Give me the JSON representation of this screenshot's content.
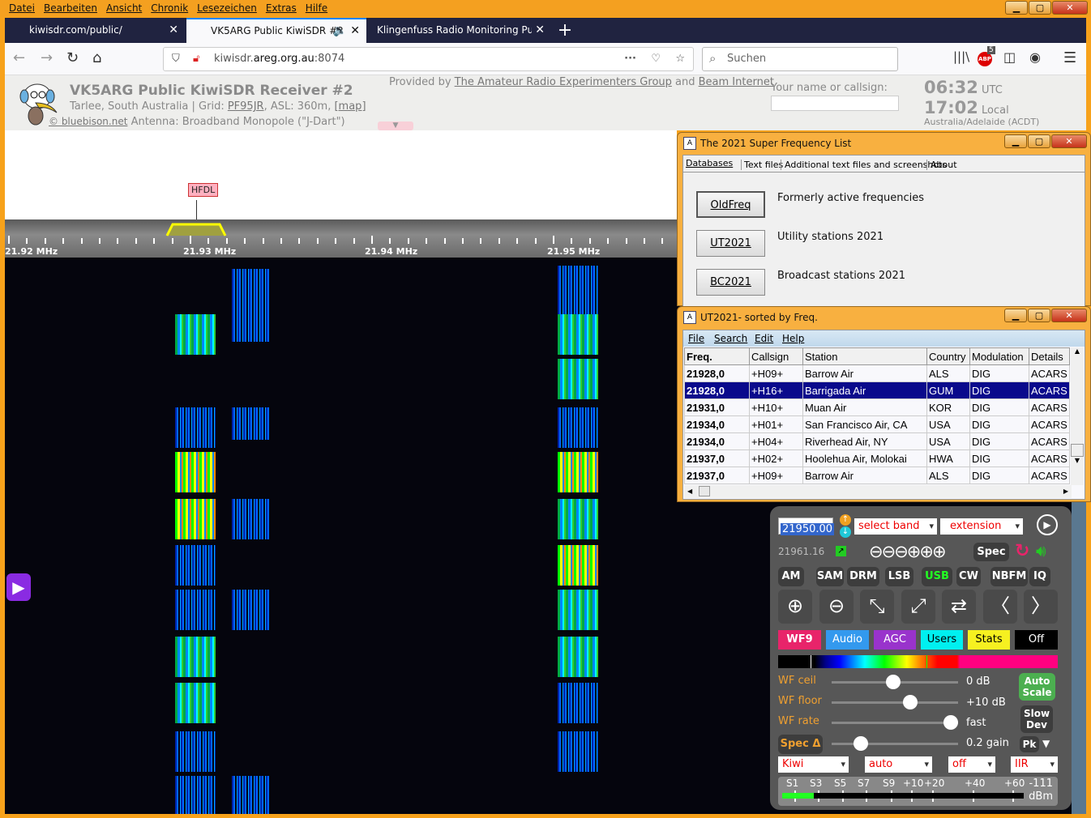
{
  "browser": {
    "menu": [
      "Datei",
      "Bearbeiten",
      "Ansicht",
      "Chronik",
      "Lesezeichen",
      "Extras",
      "Hilfe"
    ],
    "tabs": [
      {
        "label": "kiwisdr.com/public/"
      },
      {
        "label": "VK5ARG Public KiwiSDR #2",
        "active": true
      },
      {
        "label": "Klingenfuss Radio Monitoring Publi"
      }
    ],
    "url_prefix": "kiwisdr.",
    "url_domain": "areg.org.au",
    "url_suffix": ":8074",
    "search_placeholder": "Suchen",
    "abp_badge": "5"
  },
  "kiwi": {
    "title": "VK5ARG Public KiwiSDR Receiver #2",
    "location": "Tarlee, South Australia | Grid: ",
    "grid": "PF95JR",
    "asl": ", ASL: 360m, ",
    "map": "[map]",
    "credit": "© bluebison.net",
    "antenna": "Antenna: Broadband Monopole (\"J-Dart\")",
    "provided_by": "Provided by ",
    "provider1": "The Amateur Radio Experimenters Group",
    "and": " and ",
    "provider2": "Beam Internet",
    "name_label": "Your name or callsign:",
    "name_value": "",
    "utc_time": "06:32",
    "utc_label": "UTC",
    "local_time": "17:02",
    "local_label": "Local",
    "timezone": "Australia/Adelaide (ACDT)",
    "marker": "HFDL",
    "freq_ticks": [
      "21.92 MHz",
      "21.93 MHz",
      "21.94 MHz",
      "21.95 MHz"
    ]
  },
  "sfl": {
    "title": "The 2021 Super Frequency List",
    "tabs": [
      "Databases",
      "Text files",
      "Additional text files and screenshots",
      "About"
    ],
    "buttons": [
      {
        "label": "OldFreq",
        "desc": "Formerly active frequencies"
      },
      {
        "label": "UT2021",
        "desc": "Utility stations 2021"
      },
      {
        "label": "BC2021",
        "desc": "Broadcast stations 2021"
      }
    ]
  },
  "ut": {
    "title": "UT2021- sorted by Freq.",
    "menu": [
      "File",
      "Search",
      "Edit",
      "Help"
    ],
    "columns": [
      "Freq.",
      "Callsign",
      "Station",
      "Country",
      "Modulation",
      "Details"
    ],
    "rows": [
      [
        "21928,0",
        "+H09+",
        "Barrow Air",
        "ALS",
        "DIG",
        "ACARS"
      ],
      [
        "21928,0",
        "+H16+",
        "Barrigada Air",
        "GUM",
        "DIG",
        "ACARS"
      ],
      [
        "21931,0",
        "+H10+",
        "Muan Air",
        "KOR",
        "DIG",
        "ACARS"
      ],
      [
        "21934,0",
        "+H01+",
        "San Francisco Air, CA",
        "USA",
        "DIG",
        "ACARS"
      ],
      [
        "21934,0",
        "+H04+",
        "Riverhead Air, NY",
        "USA",
        "DIG",
        "ACARS"
      ],
      [
        "21937,0",
        "+H02+",
        "Hoolehua Air, Molokai",
        "HWA",
        "DIG",
        "ACARS"
      ],
      [
        "21937,0",
        "+H09+",
        "Barrow Air",
        "ALS",
        "DIG",
        "ACARS"
      ]
    ],
    "selected_row": 1
  },
  "panel": {
    "freq": "21950.00",
    "band": "select band",
    "extension": "extension",
    "cursor_freq": "21961.16",
    "spec": "Spec",
    "modes": [
      "AM",
      "SAM",
      "DRM",
      "LSB",
      "USB",
      "CW",
      "NBFM",
      "IQ"
    ],
    "active_mode": "USB",
    "toggles": [
      {
        "label": "WF9",
        "color": "#e8246a"
      },
      {
        "label": "Audio",
        "color": "#3399ee"
      },
      {
        "label": "AGC",
        "color": "#9933cc"
      },
      {
        "label": "Users",
        "color": "#00f0f0"
      },
      {
        "label": "Stats",
        "color": "#f6f020"
      },
      {
        "label": "Off",
        "color": "#000000"
      }
    ],
    "wf_ceil": {
      "label": "WF ceil",
      "value": "0 dB",
      "level": 0.5
    },
    "wf_floor": {
      "label": "WF floor",
      "value": "+10 dB",
      "level": 0.65
    },
    "wf_rate": {
      "label": "WF rate",
      "value": "fast",
      "level": 1.0
    },
    "spec_delta": {
      "label": "Spec Δ",
      "value": "0.2 gain",
      "level": 0.22
    },
    "auto_scale": "Auto Scale",
    "slow_dev": "Slow Dev",
    "pk": "Pk",
    "selects": [
      "Kiwi",
      "auto",
      "off",
      "IIR"
    ],
    "smeter_labels": [
      "S1",
      "S3",
      "S5",
      "S7",
      "S9",
      "+10",
      "+20",
      "+40",
      "+60"
    ],
    "dbm": "-111",
    "dbm_unit": "dBm",
    "smeter_level": 0.13
  }
}
